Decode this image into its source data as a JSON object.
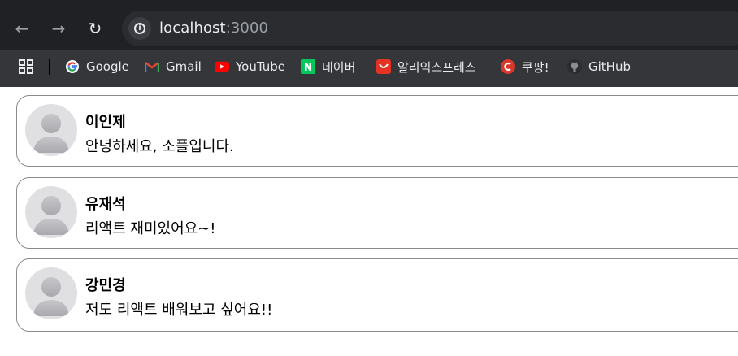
{
  "browser": {
    "url_host": "localhost",
    "url_port": ":3000",
    "bookmarks": [
      {
        "label": "Google",
        "icon": "google-icon"
      },
      {
        "label": "Gmail",
        "icon": "gmail-icon"
      },
      {
        "label": "YouTube",
        "icon": "youtube-icon"
      },
      {
        "label": "네이버",
        "icon": "naver-icon"
      },
      {
        "label": "알리익스프레스",
        "icon": "aliexpress-icon"
      },
      {
        "label": "쿠팡!",
        "icon": "coupang-icon"
      },
      {
        "label": "GitHub",
        "icon": "github-icon"
      }
    ]
  },
  "comments": [
    {
      "name": "이인제",
      "text": "안녕하세요, 소플입니다.",
      "avatar": "user-avatar-icon"
    },
    {
      "name": "유재석",
      "text": "리액트 재미있어요~!",
      "avatar": "user-avatar-icon"
    },
    {
      "name": "강민경",
      "text": "저도 리액트 배워보고 싶어요!!",
      "avatar": "user-avatar-icon"
    }
  ]
}
